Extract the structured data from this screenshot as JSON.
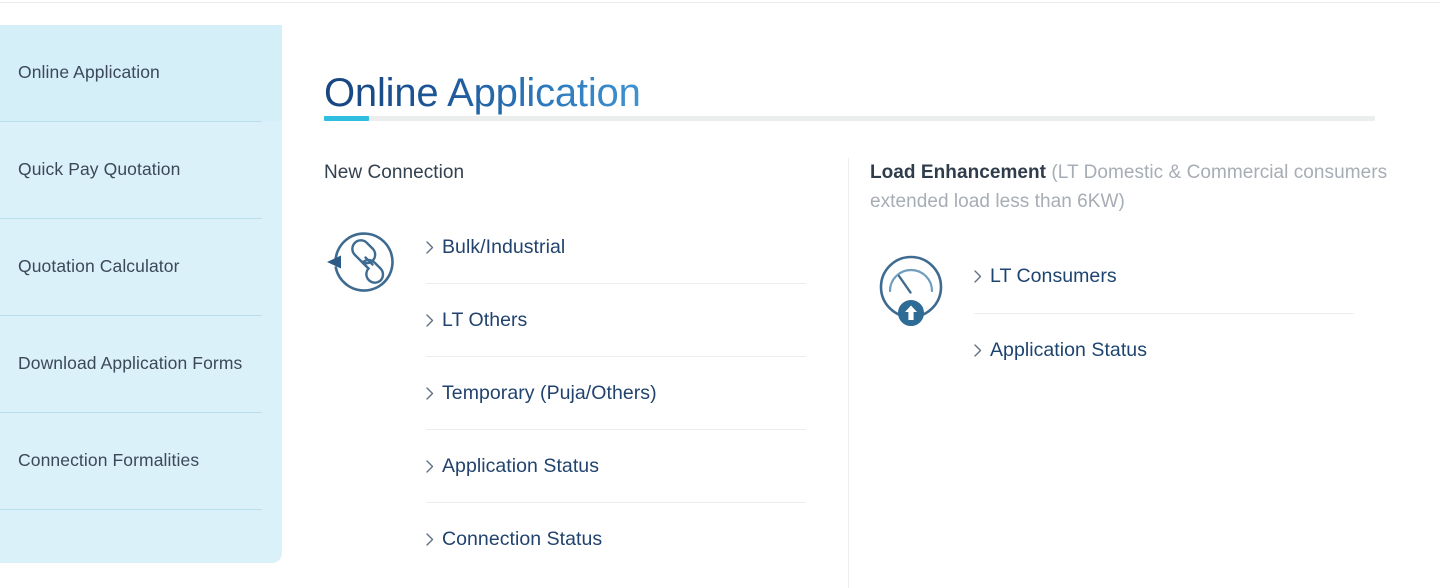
{
  "theme": {
    "sidebar_bg": "#dbf1fa",
    "sidebar_active_bg": "#d5eff9",
    "sidebar_sep": "#b9dfee",
    "title_gradient_from": "#17457f",
    "title_gradient_to": "#3f93d1",
    "accent": "#2fbde0",
    "rule": "#eceded",
    "link_color": "#21436e",
    "heading_color": "#33404f",
    "muted_color": "#a7adb4"
  },
  "sidebar": {
    "items": [
      {
        "label": "Online Application",
        "active": true
      },
      {
        "label": "Quick Pay Quotation",
        "active": false
      },
      {
        "label": "Quotation Calculator",
        "active": false
      },
      {
        "label": "Download Application Forms",
        "active": false
      },
      {
        "label": "Connection Formalities",
        "active": false
      }
    ]
  },
  "main": {
    "title": "Online Application",
    "columns": {
      "left": {
        "heading": "New Connection",
        "icon": "new-connection-icon",
        "links": [
          {
            "label": "Bulk/Industrial"
          },
          {
            "label": "LT Others"
          },
          {
            "label": "Temporary (Puja/Others)"
          },
          {
            "label": "Application Status"
          },
          {
            "label": "Connection Status"
          }
        ]
      },
      "right": {
        "heading_strong": "Load Enhancement",
        "heading_muted": " (LT Domestic & Commercial consumers extended load less than 6KW)",
        "icon": "load-enhancement-gauge-icon",
        "links": [
          {
            "label": "LT Consumers"
          },
          {
            "label": "Application Status"
          }
        ]
      }
    }
  }
}
